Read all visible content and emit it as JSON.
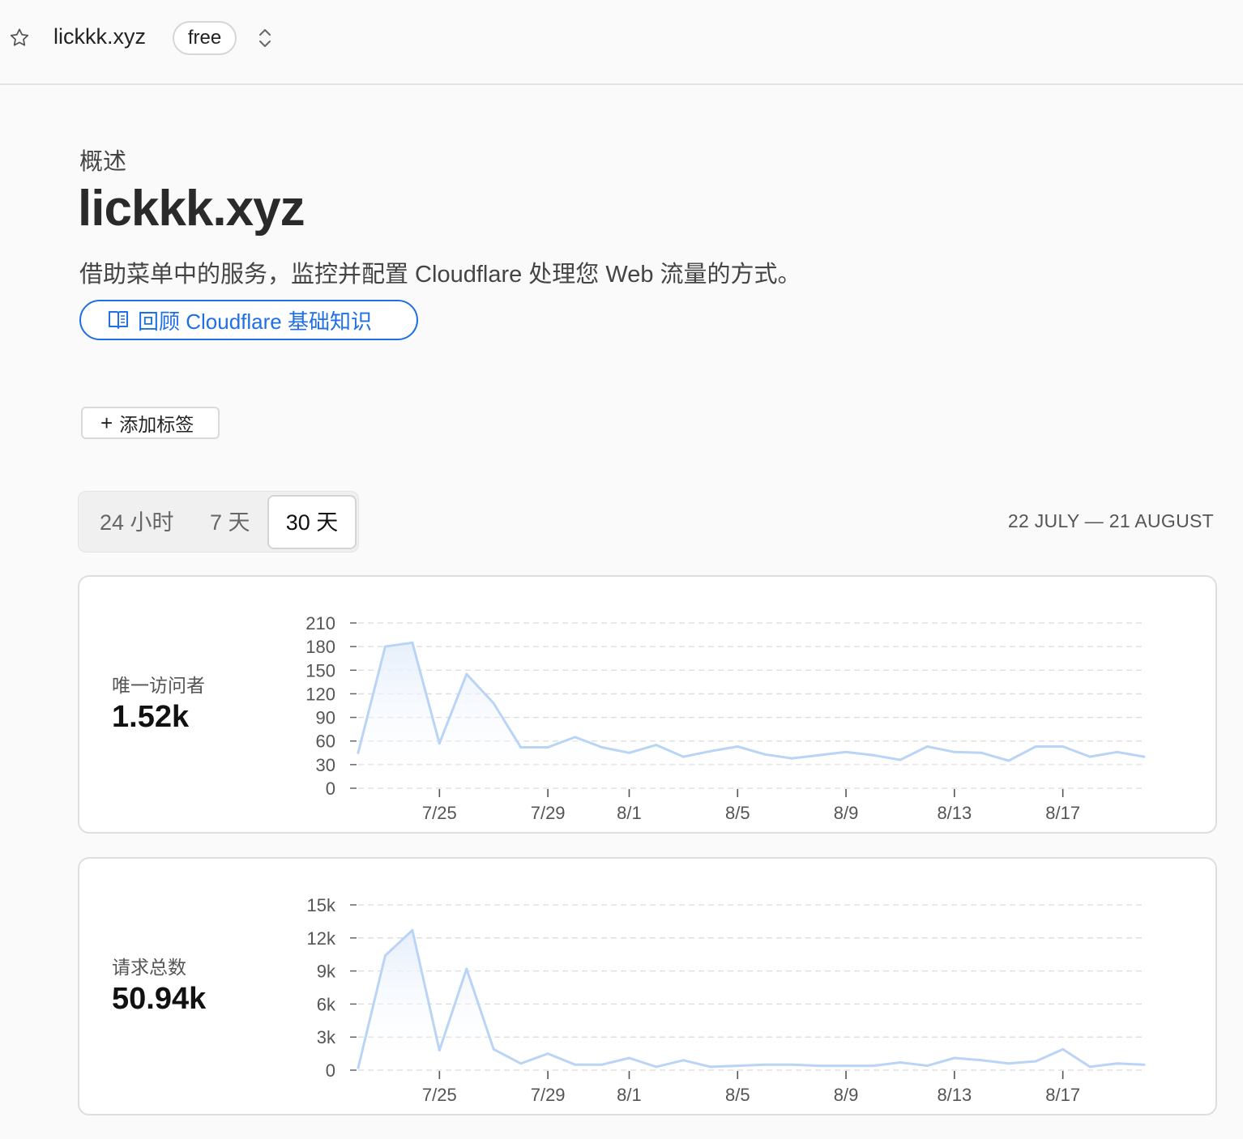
{
  "topbar": {
    "domain": "lickkk.xyz",
    "plan": "free",
    "star_icon": "star-icon",
    "switch_icon": "chevron-up-down-icon"
  },
  "header": {
    "breadcrumb": "概述",
    "title": "lickkk.xyz",
    "description": "借助菜单中的服务，监控并配置 Cloudflare 处理您 Web 流量的方式。",
    "learn_button": "回顾 Cloudflare 基础知识",
    "add_tag_button": "添加标签"
  },
  "range": {
    "tabs": [
      "24 小时",
      "7 天",
      "30 天"
    ],
    "selected": "30 天",
    "date_range": "22 JULY — 21 AUGUST"
  },
  "colors": {
    "accent": "#1f6fe5",
    "line": "#b9d4f5",
    "area_top": "#e6effc"
  },
  "metrics": [
    {
      "label": "唯一访问者",
      "value": "1.52k"
    },
    {
      "label": "请求总数",
      "value": "50.94k"
    }
  ],
  "chart_data": [
    {
      "type": "area",
      "title": "唯一访问者",
      "x": [
        "7/22",
        "7/23",
        "7/24",
        "7/25",
        "7/26",
        "7/27",
        "7/28",
        "7/29",
        "7/30",
        "7/31",
        "8/1",
        "8/2",
        "8/3",
        "8/4",
        "8/5",
        "8/6",
        "8/7",
        "8/8",
        "8/9",
        "8/10",
        "8/11",
        "8/12",
        "8/13",
        "8/14",
        "8/15",
        "8/16",
        "8/17",
        "8/18",
        "8/19",
        "8/20"
      ],
      "x_ticks": [
        "7/25",
        "7/29",
        "8/1",
        "8/5",
        "8/9",
        "8/13",
        "8/17"
      ],
      "y_ticks": [
        "0",
        "30",
        "60",
        "90",
        "120",
        "150",
        "180",
        "210"
      ],
      "ylim": [
        0,
        210
      ],
      "values": [
        45,
        180,
        185,
        57,
        145,
        108,
        52,
        52,
        65,
        52,
        45,
        55,
        40,
        47,
        53,
        43,
        38,
        42,
        46,
        42,
        36,
        53,
        46,
        45,
        35,
        53,
        53,
        40,
        46,
        40
      ],
      "grid": true
    },
    {
      "type": "area",
      "title": "请求总数",
      "x": [
        "7/22",
        "7/23",
        "7/24",
        "7/25",
        "7/26",
        "7/27",
        "7/28",
        "7/29",
        "7/30",
        "7/31",
        "8/1",
        "8/2",
        "8/3",
        "8/4",
        "8/5",
        "8/6",
        "8/7",
        "8/8",
        "8/9",
        "8/10",
        "8/11",
        "8/12",
        "8/13",
        "8/14",
        "8/15",
        "8/16",
        "8/17",
        "8/18",
        "8/19",
        "8/20"
      ],
      "x_ticks": [
        "7/25",
        "7/29",
        "8/1",
        "8/5",
        "8/9",
        "8/13",
        "8/17"
      ],
      "y_ticks": [
        "0",
        "3k",
        "6k",
        "9k",
        "12k",
        "15k"
      ],
      "ylim": [
        0,
        15000
      ],
      "values": [
        200,
        10400,
        12700,
        1800,
        9200,
        1900,
        600,
        1500,
        500,
        500,
        1100,
        300,
        900,
        300,
        400,
        500,
        500,
        400,
        400,
        400,
        700,
        400,
        1100,
        900,
        600,
        800,
        1900,
        300,
        600,
        500
      ],
      "grid": true
    }
  ]
}
